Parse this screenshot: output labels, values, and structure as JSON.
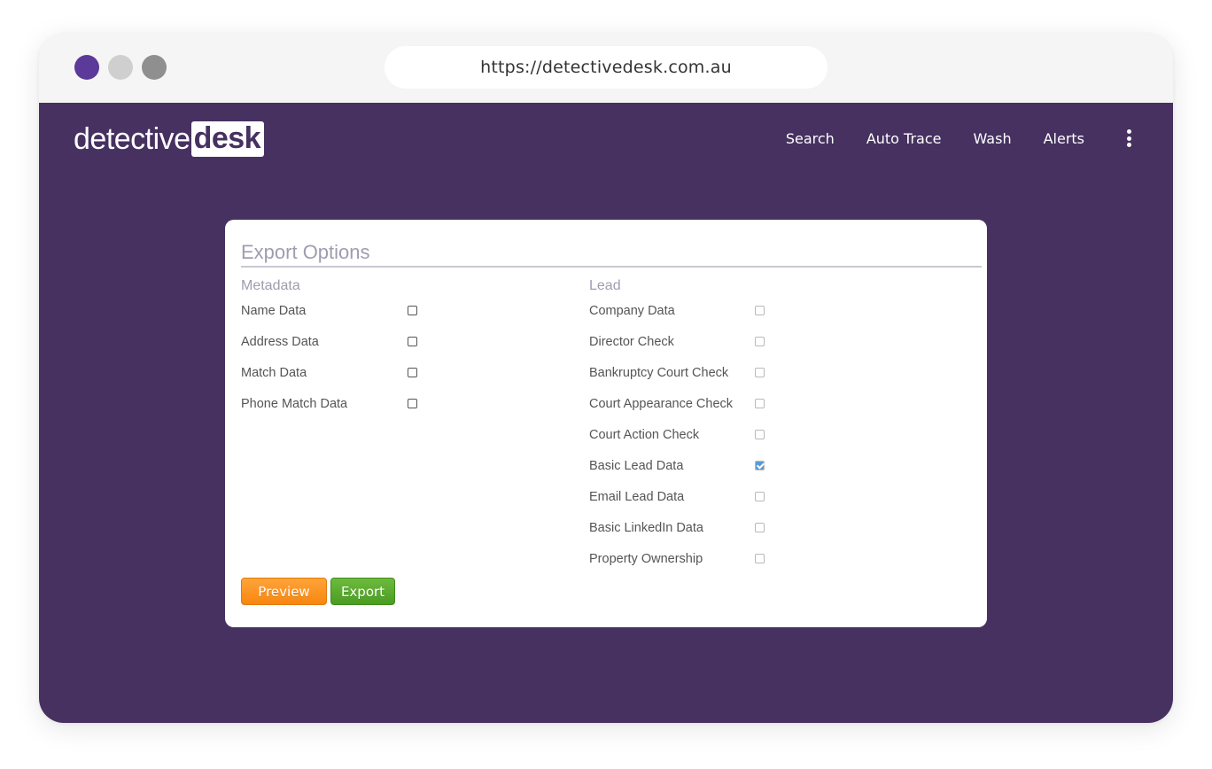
{
  "browser": {
    "url": "https://detectivedesk.com.au"
  },
  "header": {
    "logo_part1": "detective",
    "logo_part2": "desk",
    "nav": [
      "Search",
      "Auto Trace",
      "Wash",
      "Alerts"
    ],
    "more_icon": "kebab-menu-icon"
  },
  "export_options": {
    "title": "Export Options",
    "metadata": {
      "heading": "Metadata",
      "items": [
        {
          "label": "Name Data",
          "checked": false
        },
        {
          "label": "Address Data",
          "checked": false
        },
        {
          "label": "Match Data",
          "checked": false
        },
        {
          "label": "Phone Match Data",
          "checked": false
        }
      ]
    },
    "lead": {
      "heading": "Lead",
      "items": [
        {
          "label": "Company Data",
          "checked": false
        },
        {
          "label": "Director Check",
          "checked": false
        },
        {
          "label": "Bankruptcy Court Check",
          "checked": false
        },
        {
          "label": "Court Appearance Check",
          "checked": false
        },
        {
          "label": "Court Action Check",
          "checked": false
        },
        {
          "label": "Basic Lead Data",
          "checked": true
        },
        {
          "label": "Email Lead Data",
          "checked": false
        },
        {
          "label": "Basic LinkedIn Data",
          "checked": false
        },
        {
          "label": "Property Ownership",
          "checked": false
        }
      ]
    },
    "preview_label": "Preview",
    "export_label": "Export"
  },
  "colors": {
    "brand": "#463161",
    "preview_button": "#f7860f",
    "export_button": "#4a9c22",
    "checked": "#5b9bd5"
  }
}
